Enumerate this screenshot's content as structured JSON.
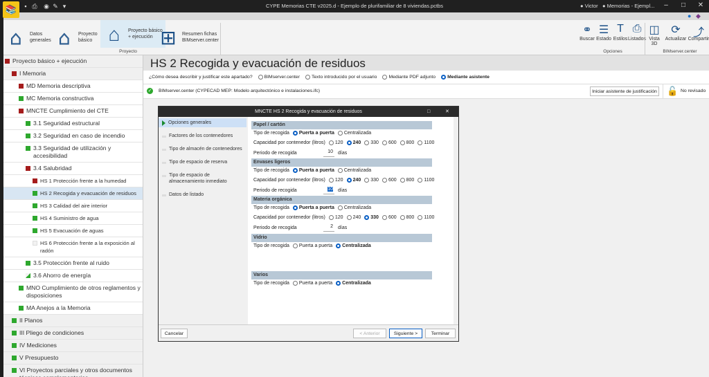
{
  "window": {
    "title": "CYPE Memorias CTE v2025.d - Ejemplo de plurifamiliar de 8 viviendas.pctbs",
    "user": "Victor",
    "document": "Memorias - Ejempl..."
  },
  "ribbon": {
    "left": [
      {
        "label": "Datos\ngenerales",
        "icon": "house-gear-icon"
      },
      {
        "label": "Proyecto\nbásico",
        "icon": "house-outline-icon"
      },
      {
        "label": "Proyecto básico\n+ ejecución",
        "icon": "house-filled-icon"
      },
      {
        "label": "Resumen fichas\nBIMserver.center",
        "icon": "hierarchy-icon"
      }
    ],
    "group_proyecto": "Proyecto",
    "options": [
      {
        "label": "Buscar",
        "icon": "binoculars-icon"
      },
      {
        "label": "Estado",
        "icon": "checklist-icon"
      },
      {
        "label": "Estilos",
        "icon": "text-style-icon"
      },
      {
        "label": "Listados",
        "icon": "printer-icon"
      }
    ],
    "group_opciones": "Opciones",
    "bim": [
      {
        "label": "Vista\n3D",
        "icon": "cube-icon"
      },
      {
        "label": "Actualizar",
        "icon": "refresh-icon"
      },
      {
        "label": "Compartir",
        "icon": "share-icon"
      }
    ],
    "group_bim": "BIMserver.center"
  },
  "colors": {
    "red": "#a51c1c",
    "green": "#2ea82e",
    "empty": "#f2f2f2"
  },
  "tree": [
    {
      "label": "Proyecto básico + ejecución",
      "level": 0,
      "status": "red",
      "bg": "gray"
    },
    {
      "label": "I Memoria",
      "level": 1,
      "status": "red",
      "bg": "gray"
    },
    {
      "label": "MD Memoria descriptiva",
      "level": 2,
      "status": "red",
      "bg": "white"
    },
    {
      "label": "MC Memoria constructiva",
      "level": 2,
      "status": "green",
      "bg": "white"
    },
    {
      "label": "MNCTE Cumplimiento del CTE",
      "level": 2,
      "status": "red",
      "bg": "white"
    },
    {
      "label": "3.1 Seguridad estructural",
      "level": 3,
      "status": "green",
      "bg": "white"
    },
    {
      "label": "3.2 Seguridad en caso de incendio",
      "level": 3,
      "status": "green",
      "bg": "white"
    },
    {
      "label": "3.3 Seguridad de utilización y accesibilidad",
      "level": 3,
      "status": "green",
      "bg": "white"
    },
    {
      "label": "3.4 Salubridad",
      "level": 3,
      "status": "red",
      "bg": "white"
    },
    {
      "label": "HS 1 Protección frente a la humedad",
      "level": 4,
      "status": "red",
      "bg": "white"
    },
    {
      "label": "HS 2 Recogida y evacuación de residuos",
      "level": 4,
      "status": "green",
      "bg": "sel"
    },
    {
      "label": "HS 3 Calidad del aire interior",
      "level": 4,
      "status": "green",
      "bg": "white"
    },
    {
      "label": "HS 4 Suministro de agua",
      "level": 4,
      "status": "green",
      "bg": "white"
    },
    {
      "label": "HS 5 Evacuación de aguas",
      "level": 4,
      "status": "green",
      "bg": "white"
    },
    {
      "label": "HS 6 Protección frente a la exposición al radón",
      "level": 4,
      "status": "empty",
      "bg": "white"
    },
    {
      "label": "3.5 Protección frente al ruido",
      "level": 3,
      "status": "green",
      "bg": "white"
    },
    {
      "label": "3.6 Ahorro de energía",
      "level": 3,
      "status": "partial",
      "bg": "white"
    },
    {
      "label": "MNO Cumplimiento de otros reglamentos y disposiciones",
      "level": 2,
      "status": "green",
      "bg": "white"
    },
    {
      "label": "MA Anejos a la Memoria",
      "level": 2,
      "status": "green",
      "bg": "white"
    },
    {
      "label": "II Planos",
      "level": 1,
      "status": "green",
      "bg": "gray"
    },
    {
      "label": "III Pliego de condiciones",
      "level": 1,
      "status": "green",
      "bg": "gray"
    },
    {
      "label": "IV Mediciones",
      "level": 1,
      "status": "green",
      "bg": "gray"
    },
    {
      "label": "V Presupuesto",
      "level": 1,
      "status": "green",
      "bg": "gray"
    },
    {
      "label": "VI Proyectos parciales y otros documentos técnicos complementarios",
      "level": 1,
      "status": "green",
      "bg": "gray"
    }
  ],
  "main": {
    "title": "HS 2 Recogida y evacuación de residuos",
    "question": "¿Cómo desea describir y justificar este apartado?",
    "modes": [
      {
        "label": "BIMserver.center",
        "on": false
      },
      {
        "label": "Texto introducido por el usuario",
        "on": false
      },
      {
        "label": "Mediante PDF adjunto",
        "on": false
      },
      {
        "label": "Mediante asistente",
        "on": true
      }
    ],
    "source": "BIMserver.center (CYPECAD MEP: Modelo arquitectónico e instalaciones.ifc)",
    "start_button": "Iniciar asistente de justificación",
    "review_status": "No revisado"
  },
  "dialog": {
    "title": "MNCTE HS 2 Recogida y evacuación de residuos",
    "nav": [
      {
        "label": "Opciones generales",
        "active": true
      },
      {
        "label": "Factores de los contenedores"
      },
      {
        "label": "Tipo de almacén de contenedores"
      },
      {
        "label": "Tipo de espacio de reserva"
      },
      {
        "label": "Tipo de espacio de almacenamiento inmediato"
      },
      {
        "label": "Datos de listado"
      }
    ],
    "labels": {
      "tipo": "Tipo de recogida",
      "capacidad": "Capacidad por contenedor (litros)",
      "periodo": "Periodo de recogida",
      "dias": "días"
    },
    "tipo_options": [
      "Puerta a puerta",
      "Centralizada"
    ],
    "capacity_options": [
      "120",
      "240",
      "330",
      "600",
      "800",
      "1100"
    ],
    "sections": [
      {
        "name": "Papel / cartón",
        "tipo": "Puerta a puerta",
        "capacidad": "240",
        "periodo": "10"
      },
      {
        "name": "Envases ligeros",
        "tipo": "Puerta a puerta",
        "capacidad": "240",
        "periodo": "10",
        "focus": true
      },
      {
        "name": "Materia orgánica",
        "tipo": "Puerta a puerta",
        "capacidad": "330",
        "periodo": "2"
      },
      {
        "name": "Vidrio",
        "tipo": "Centralizada"
      },
      {
        "name": "Varios",
        "tipo": "Centralizada"
      }
    ],
    "buttons": {
      "cancel": "Cancelar",
      "prev": "< Anterior",
      "next": "Siguiente >",
      "finish": "Terminar"
    }
  }
}
